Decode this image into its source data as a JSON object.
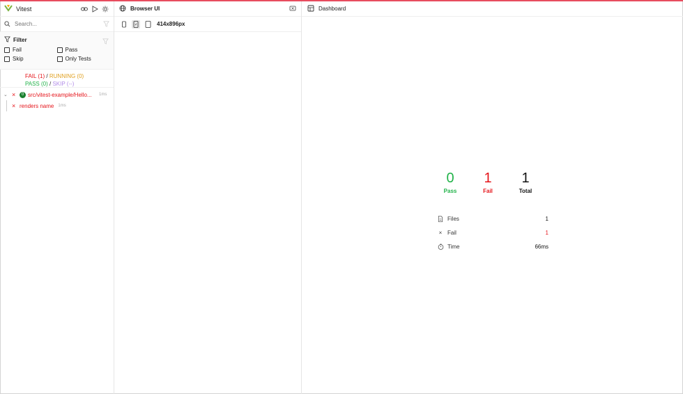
{
  "colors": {
    "accent_top": "#e74c5e",
    "fail": "#e5141a",
    "pass": "#22b34a",
    "running": "#e0a020",
    "skip": "#b28ce8",
    "badge": "#1a7f2e"
  },
  "sidebar": {
    "title": "Vitest",
    "search_placeholder": "Search...",
    "filter": {
      "title": "Filter",
      "options": [
        "Fail",
        "Pass",
        "Skip",
        "Only Tests"
      ]
    },
    "summary": {
      "fail": "FAIL (1)",
      "running": "RUNNING (0)",
      "pass": "PASS (0)",
      "skip": "SKIP (--)",
      "separator": "/"
    },
    "tree": {
      "file": {
        "badge": "0",
        "name": "src/vitest-example/Hello...",
        "duration": "1ms"
      },
      "test": {
        "name": "renders name",
        "duration": "1ms"
      }
    }
  },
  "browser": {
    "title": "Browser UI",
    "viewport": "414x896px"
  },
  "dashboard": {
    "title": "Dashboard",
    "stats": {
      "pass": {
        "value": "0",
        "label": "Pass"
      },
      "fail": {
        "value": "1",
        "label": "Fail"
      },
      "total": {
        "value": "1",
        "label": "Total"
      }
    },
    "details": {
      "files": {
        "label": "Files",
        "value": "1"
      },
      "fail": {
        "label": "Fail",
        "value": "1"
      },
      "time": {
        "label": "Time",
        "value": "66ms"
      }
    }
  }
}
